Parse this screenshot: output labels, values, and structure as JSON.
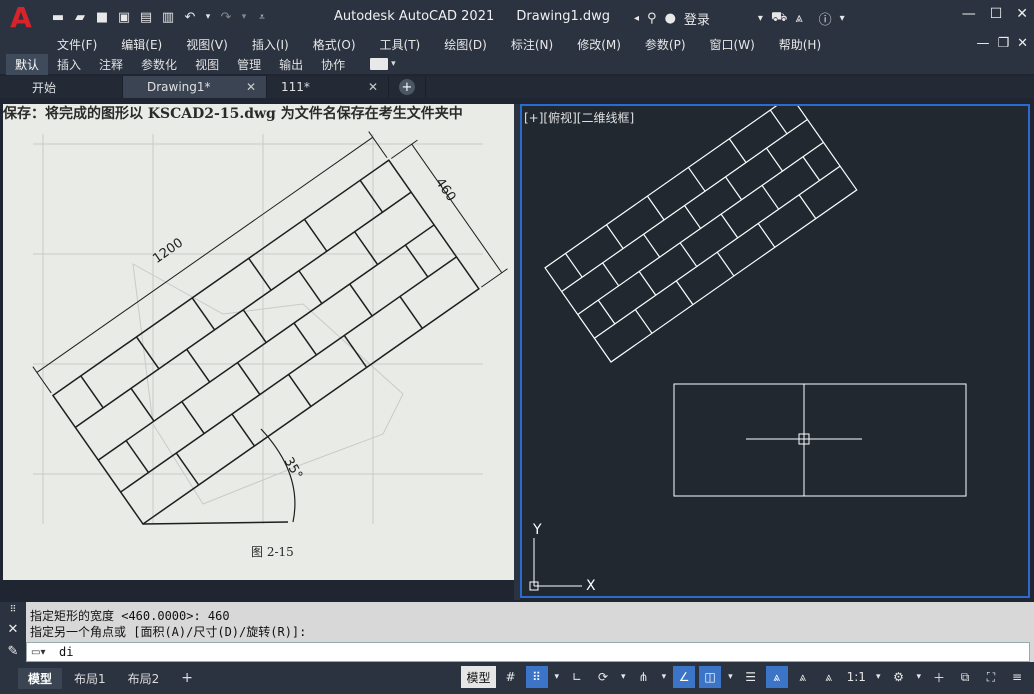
{
  "app": {
    "name": "Autodesk AutoCAD 2021",
    "document": "Drawing1.dwg",
    "logo_letter": "A"
  },
  "titlebar": {
    "login_label": "登录",
    "quick_access": [
      "new-icon",
      "open-icon",
      "save-icon",
      "save-as-icon",
      "publish-icon",
      "plot-icon",
      "undo-icon",
      "redo-icon",
      "qat-menu-icon"
    ]
  },
  "menu": {
    "items": [
      "文件(F)",
      "编辑(E)",
      "视图(V)",
      "插入(I)",
      "格式(O)",
      "工具(T)",
      "绘图(D)",
      "标注(N)",
      "修改(M)",
      "参数(P)",
      "窗口(W)",
      "帮助(H)"
    ]
  },
  "ribbon": {
    "tabs": [
      "默认",
      "插入",
      "注释",
      "参数化",
      "视图",
      "管理",
      "输出",
      "协作"
    ],
    "active": "默认"
  },
  "file_tabs": {
    "tabs": [
      {
        "label": "开始",
        "closable": false
      },
      {
        "label": "Drawing1*",
        "closable": true
      },
      {
        "label": "111*",
        "closable": true
      }
    ],
    "active": "Drawing1*"
  },
  "right_viewport": {
    "label": "[+][俯视][二维线框]",
    "ucs": {
      "y": "Y",
      "x": "X"
    }
  },
  "left_image": {
    "heading": "保存：将完成的图形以 KSCAD2-15.dwg 为文件名保存在考生文件夹中",
    "dim_length": "1200",
    "dim_width": "460",
    "angle": "35°",
    "figure": "图 2-15"
  },
  "command": {
    "history": [
      "指定矩形的宽度 <460.0000>: 460",
      "指定另一个角点或 [面积(A)/尺寸(D)/旋转(R)]:"
    ],
    "input": "di"
  },
  "layout_tabs": {
    "tabs": [
      "模型",
      "布局1",
      "布局2"
    ],
    "active": "模型"
  },
  "status": {
    "model_label": "模型",
    "scale_label": "1:1"
  },
  "colors": {
    "accent": "#2a6bd1",
    "logo": "#d8232a",
    "canvas": "#212830"
  }
}
